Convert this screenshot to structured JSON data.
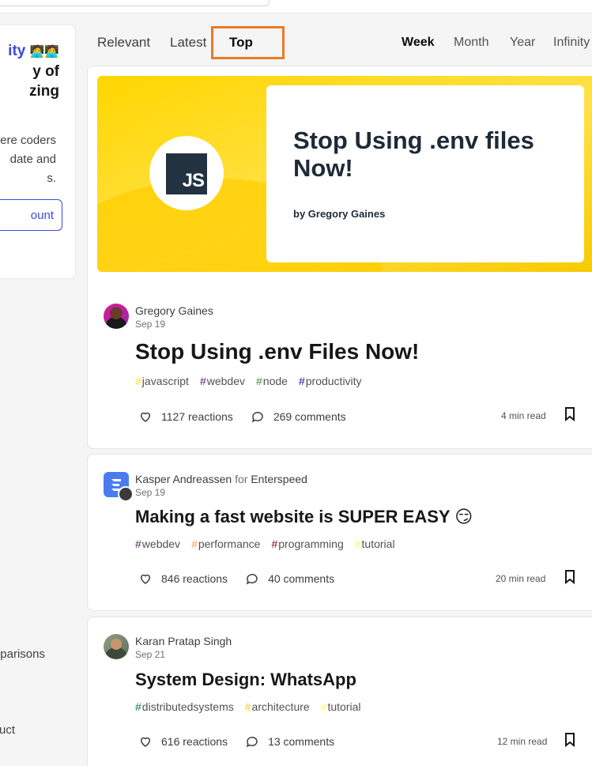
{
  "sidebar": {
    "title_accent": "ity",
    "title_emoji": "🧑‍💻🧑‍💻",
    "title_line2": "y of",
    "title_line3": "zing",
    "desc_line1": "ere coders",
    "desc_line2": "date and",
    "desc_line3": "s.",
    "create_account": "ount",
    "link_comparisons": "parisons",
    "link_product": "uct"
  },
  "feed_tabs": {
    "relevant": "Relevant",
    "latest": "Latest",
    "top": "Top"
  },
  "range_tabs": {
    "week": "Week",
    "month": "Month",
    "year": "Year",
    "infinity": "Infinity"
  },
  "posts": [
    {
      "cover_title": "Stop Using .env files Now!",
      "cover_byline": "by Gregory Gaines",
      "cover_logo": "JS",
      "author": "Gregory Gaines",
      "date": "Sep 19",
      "title": "Stop Using .env Files Now!",
      "tags": [
        {
          "name": "javascript",
          "color": "#f7df1e"
        },
        {
          "name": "webdev",
          "color": "#562765"
        },
        {
          "name": "node",
          "color": "#3c873a"
        },
        {
          "name": "productivity",
          "color": "#2a0798"
        }
      ],
      "reactions": "1127 reactions",
      "comments": "269 comments",
      "read_time": "4 min read"
    },
    {
      "author": "Kasper Andreassen",
      "for_label": "for",
      "org": "Enterspeed",
      "date": "Sep 19",
      "title": "Making a fast website is SUPER EASY 😏",
      "tags": [
        {
          "name": "webdev",
          "color": "#562765"
        },
        {
          "name": "performance",
          "color": "#f49e52"
        },
        {
          "name": "programming",
          "color": "#890606"
        },
        {
          "name": "tutorial",
          "color": "#fef85a"
        }
      ],
      "reactions": "846 reactions",
      "comments": "40 comments",
      "read_time": "20 min read"
    },
    {
      "author": "Karan Pratap Singh",
      "date": "Sep 21",
      "title": "System Design: WhatsApp",
      "tags": [
        {
          "name": "distributedsystems",
          "color": "#0d6d54"
        },
        {
          "name": "architecture",
          "color": "#ffca28"
        },
        {
          "name": "tutorial",
          "color": "#fef85a"
        }
      ],
      "reactions": "616 reactions",
      "comments": "13 comments",
      "read_time": "12 min read"
    }
  ],
  "colors": {
    "accent": "#3b49df",
    "highlight": "#ea7a26"
  }
}
